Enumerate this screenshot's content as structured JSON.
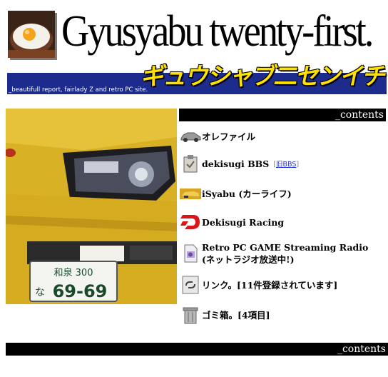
{
  "header": {
    "title": "Gyusyabu twenty-first.",
    "subtitle": "_beautifull report, fairlady Z and  retro PC site.",
    "katakana": "ギュウシャブ二センイチ"
  },
  "hero": {
    "plate_top": "和泉 300",
    "plate_prefix": "な",
    "plate_number": "69-69"
  },
  "contents_label_top": "_contents",
  "contents_label_bottom": "_contents",
  "menu": [
    {
      "label": "オレファイル",
      "icon": "car-silhouette-icon"
    },
    {
      "label": "dekisugi BBS",
      "icon": "clipboard-icon",
      "old_link": {
        "open": "[",
        "text": "旧BBS",
        "close": "]"
      }
    },
    {
      "label": "iSyabu (カーライフ)",
      "icon": "yellow-car-icon"
    },
    {
      "label": "Dekisugi Racing",
      "icon": "racing-logo-icon"
    },
    {
      "label_line1": "Retro PC GAME Streaming Radio",
      "label_line2": "(ネットラジオ放送中!)",
      "icon": "radio-document-icon"
    },
    {
      "label": "リンク。[11件登録されています]",
      "icon": "link-chain-icon"
    },
    {
      "label": "ゴミ箱。[4項目]",
      "icon": "trash-can-icon"
    }
  ],
  "colors": {
    "banner_blue": "#1c2b8c",
    "katakana_yellow": "#ffe100",
    "car_yellow": "#e3bc2a",
    "link_blue": "#2233cc"
  }
}
